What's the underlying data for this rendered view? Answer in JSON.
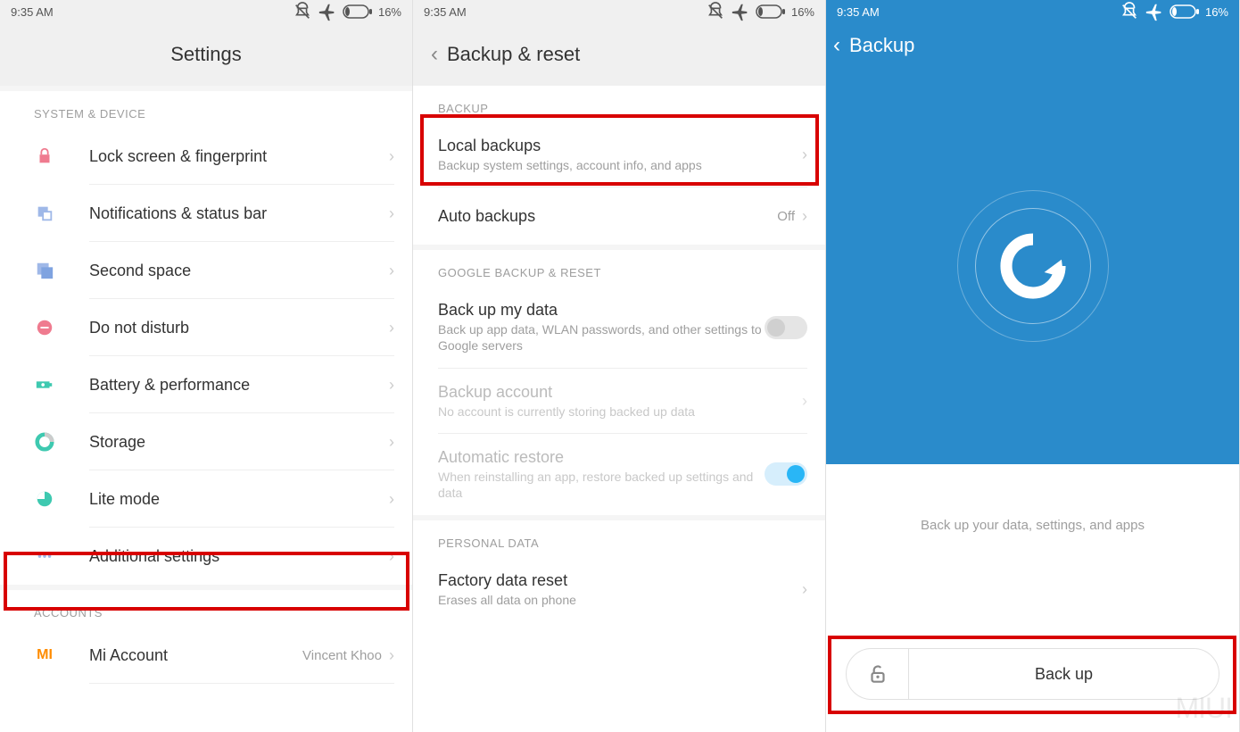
{
  "status": {
    "time": "9:35 AM",
    "battery": "16%"
  },
  "screen1": {
    "title": "Settings",
    "section1": "SYSTEM & DEVICE",
    "items": [
      {
        "label": "Lock screen & fingerprint"
      },
      {
        "label": "Notifications & status bar"
      },
      {
        "label": "Second space"
      },
      {
        "label": "Do not disturb"
      },
      {
        "label": "Battery & performance"
      },
      {
        "label": "Storage"
      },
      {
        "label": "Lite mode"
      },
      {
        "label": "Additional settings"
      }
    ],
    "section2": "ACCOUNTS",
    "account": {
      "label": "Mi Account",
      "value": "Vincent Khoo"
    }
  },
  "screen2": {
    "title": "Backup & reset",
    "section1": "BACKUP",
    "local": {
      "label": "Local backups",
      "sub": "Backup system settings, account info, and apps"
    },
    "auto": {
      "label": "Auto backups",
      "value": "Off"
    },
    "section2": "GOOGLE BACKUP & RESET",
    "backupdata": {
      "label": "Back up my data",
      "sub": "Back up app data, WLAN passwords, and other settings to Google servers"
    },
    "backupacct": {
      "label": "Backup account",
      "sub": "No account is currently storing backed up data"
    },
    "autorestore": {
      "label": "Automatic restore",
      "sub": "When reinstalling an app, restore backed up settings and data"
    },
    "section3": "PERSONAL DATA",
    "factory": {
      "label": "Factory data reset",
      "sub": "Erases all data on phone"
    }
  },
  "screen3": {
    "title": "Backup",
    "caption": "Back up your data, settings, and apps",
    "button": "Back up"
  }
}
